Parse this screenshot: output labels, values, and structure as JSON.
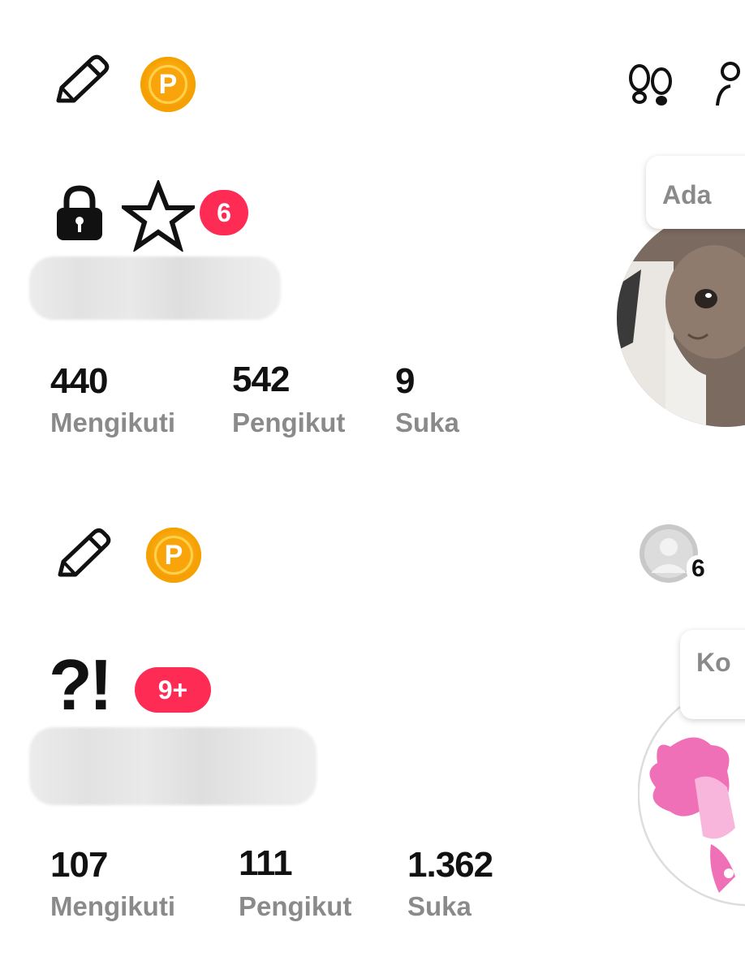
{
  "profile_a": {
    "notif_count": "6",
    "bubble_text": "Ada",
    "stats": [
      {
        "value": "440",
        "label": "Mengikuti"
      },
      {
        "value": "542",
        "label": "Pengikut"
      },
      {
        "value": "9",
        "label": "Suka"
      }
    ]
  },
  "profile_b": {
    "notif_count": "9+",
    "friends_count": "6",
    "bubble_text": "Ko",
    "title_glyph": "?!",
    "stats": [
      {
        "value": "107",
        "label": "Mengikuti"
      },
      {
        "value": "111",
        "label": "Pengikut"
      },
      {
        "value": "1.362",
        "label": "Suka"
      }
    ]
  },
  "icons": {
    "coin_letter": "P",
    "star": "☆"
  },
  "colors": {
    "badge": "#fe2c55",
    "coin": "#f8a20a",
    "muted": "#8a8a8a"
  }
}
